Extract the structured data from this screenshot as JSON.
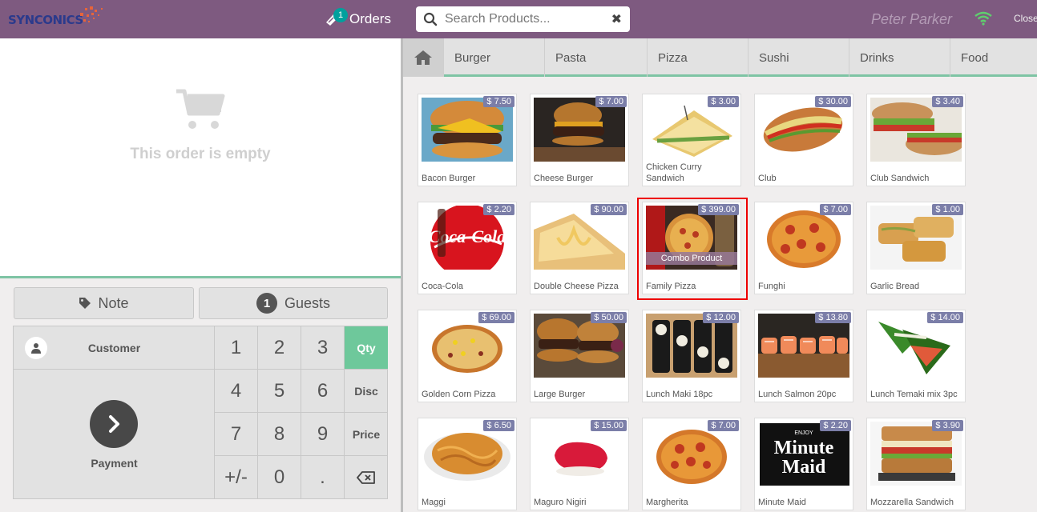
{
  "header": {
    "brand": "SYNCONICS",
    "orders_count": "1",
    "orders_label": "Orders",
    "search_placeholder": "Search Products...",
    "user_name": "Peter Parker",
    "close_label": "Close"
  },
  "order": {
    "empty_message": "This order is empty"
  },
  "controls": {
    "note_label": "Note",
    "guests_count": "1",
    "guests_label": "Guests",
    "customer_label": "Customer",
    "payment_label": "Payment"
  },
  "numpad": {
    "keys": [
      "1",
      "2",
      "3",
      "4",
      "5",
      "6",
      "7",
      "8",
      "9",
      "+/-",
      "0",
      "."
    ],
    "modes": [
      "Qty",
      "Disc",
      "Price"
    ],
    "selected_mode": "Qty"
  },
  "categories": [
    "Burger",
    "Pasta",
    "Pizza",
    "Sushi",
    "Drinks",
    "Food"
  ],
  "products": [
    {
      "name": "Bacon Burger",
      "price": "$ 7.50"
    },
    {
      "name": "Cheese Burger",
      "price": "$ 7.00"
    },
    {
      "name": "Chicken Curry Sandwich",
      "price": "$ 3.00"
    },
    {
      "name": "Club",
      "price": "$ 30.00"
    },
    {
      "name": "Club Sandwich",
      "price": "$ 3.40"
    },
    {
      "name": "Coca-Cola",
      "price": "$ 2.20"
    },
    {
      "name": "Double Cheese Pizza",
      "price": "$ 90.00"
    },
    {
      "name": "Family Pizza",
      "price": "$ 399.00",
      "tag": "Combo Product"
    },
    {
      "name": "Funghi",
      "price": "$ 7.00"
    },
    {
      "name": "Garlic Bread",
      "price": "$ 1.00"
    },
    {
      "name": "Golden Corn Pizza",
      "price": "$ 69.00"
    },
    {
      "name": "Large Burger",
      "price": "$ 50.00"
    },
    {
      "name": "Lunch Maki 18pc",
      "price": "$ 12.00"
    },
    {
      "name": "Lunch Salmon 20pc",
      "price": "$ 13.80"
    },
    {
      "name": "Lunch Temaki mix 3pc",
      "price": "$ 14.00"
    },
    {
      "name": "Maggi",
      "price": "$ 6.50"
    },
    {
      "name": "Maguro Nigiri",
      "price": "$ 15.00"
    },
    {
      "name": "Margherita",
      "price": "$ 7.00"
    },
    {
      "name": "Minute Maid",
      "price": "$ 2.20",
      "logo_text": [
        "ENJOY",
        "Minute",
        "Maid"
      ]
    },
    {
      "name": "Mozzarella Sandwich",
      "price": "$ 3.90"
    }
  ],
  "colors": {
    "header_bg": "#7e5a80",
    "accent_green": "#6ec89b",
    "price_badge": "#7b7ea8",
    "highlight": "#e00000"
  }
}
